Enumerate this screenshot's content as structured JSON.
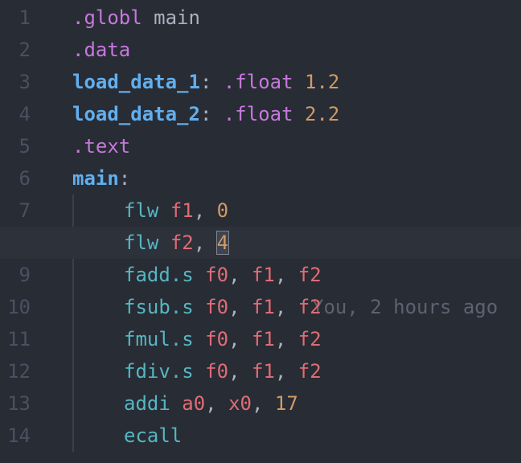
{
  "editor": {
    "active_line": 8,
    "lines": [
      {
        "number": "1",
        "tokens": [
          ".globl",
          " ",
          "main"
        ]
      },
      {
        "number": "2",
        "tokens": [
          ".data"
        ]
      },
      {
        "number": "3",
        "tokens": [
          "load_data_1",
          ": ",
          ".float",
          " ",
          "1.2"
        ]
      },
      {
        "number": "4",
        "tokens": [
          "load_data_2",
          ": ",
          ".float",
          " ",
          "2.2"
        ]
      },
      {
        "number": "5",
        "tokens": [
          ".text"
        ]
      },
      {
        "number": "6",
        "tokens": [
          "main",
          ":"
        ]
      },
      {
        "number": "7",
        "tokens": [
          "flw",
          " ",
          "f1",
          ", ",
          "0"
        ]
      },
      {
        "number": "8",
        "tokens": [
          "flw",
          " ",
          "f2",
          ", ",
          "4"
        ]
      },
      {
        "number": "9",
        "tokens": [
          "fadd.s",
          " ",
          "f0",
          ", ",
          "f1",
          ", ",
          "f2"
        ]
      },
      {
        "number": "10",
        "tokens": [
          "fsub.s",
          " ",
          "f0",
          ", ",
          "f1",
          ", ",
          "f2"
        ]
      },
      {
        "number": "11",
        "tokens": [
          "fmul.s",
          " ",
          "f0",
          ", ",
          "f1",
          ", ",
          "f2"
        ]
      },
      {
        "number": "12",
        "tokens": [
          "fdiv.s",
          " ",
          "f0",
          ", ",
          "f1",
          ", ",
          "f2"
        ]
      },
      {
        "number": "13",
        "tokens": [
          "addi",
          " ",
          "a0",
          ", ",
          "x0",
          ", ",
          "17"
        ]
      },
      {
        "number": "14",
        "tokens": [
          "ecall"
        ]
      }
    ],
    "blame_annotation": "You, 2 hours ago"
  },
  "colors": {
    "background": "#282c34",
    "active_line": "#2c313a",
    "directive": "#c678dd",
    "label": "#61afef",
    "number": "#d19a66",
    "instruction": "#56b6c2",
    "register": "#e06c75",
    "text": "#abb2bf",
    "comment": "#5c6370"
  }
}
